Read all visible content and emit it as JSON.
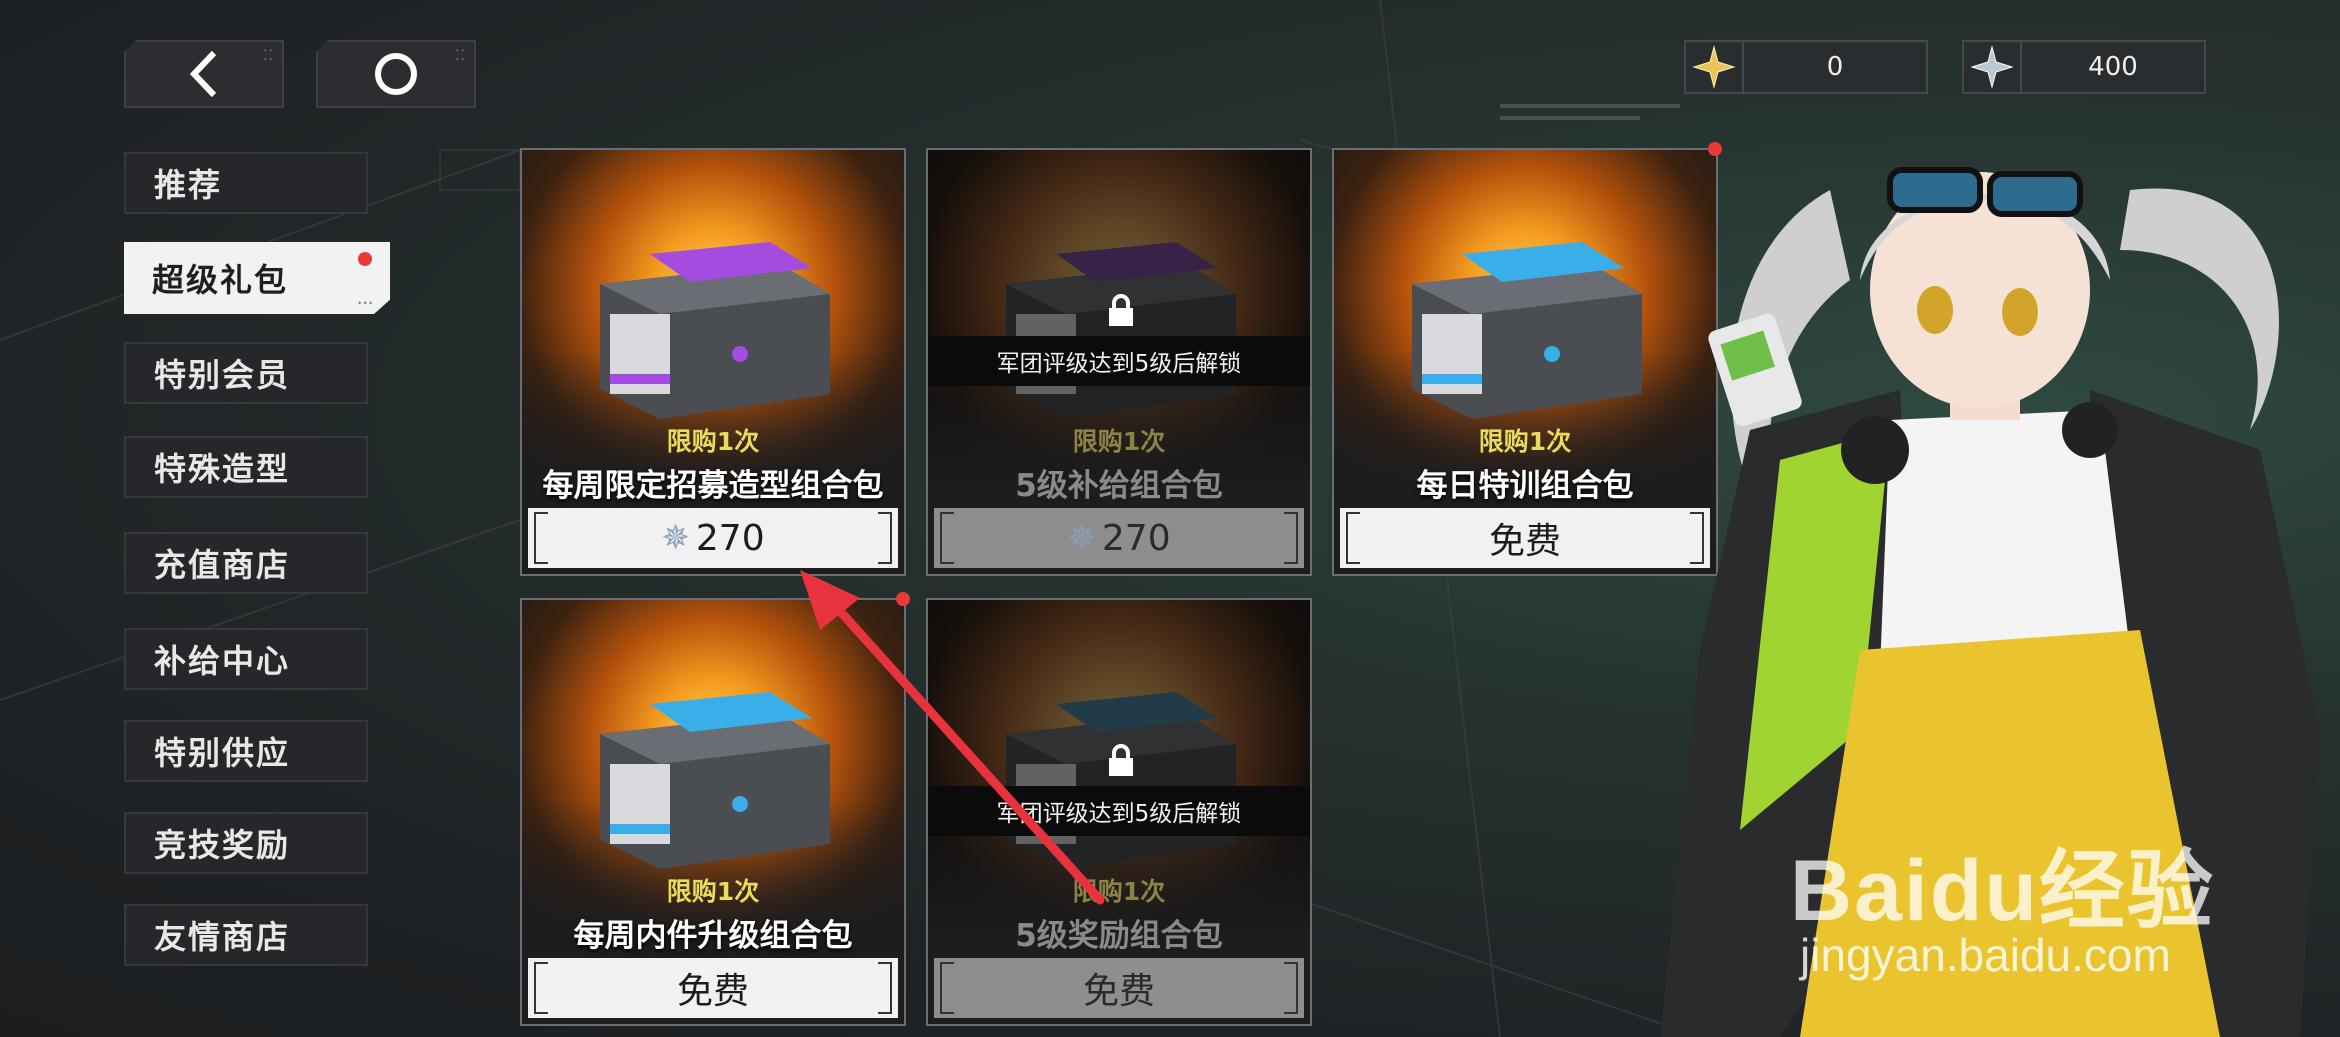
{
  "top_bar": {
    "back_icon": "chevron-left-icon",
    "home_icon": "ring-home-icon",
    "currencies": [
      {
        "icon": "gold-star-icon",
        "value": "0",
        "color": "#e8c45a"
      },
      {
        "icon": "silver-star-icon",
        "value": "400",
        "color": "#b9c7d4"
      }
    ]
  },
  "sidebar": {
    "items": [
      {
        "label": "推荐",
        "active": false
      },
      {
        "label": "超级礼包",
        "active": true,
        "badge": true
      },
      {
        "label": "特别会员",
        "active": false
      },
      {
        "label": "特殊造型",
        "active": false
      },
      {
        "label": "充值商店",
        "active": false
      },
      {
        "label": "补给中心",
        "active": false
      },
      {
        "label": "特别供应",
        "active": false
      },
      {
        "label": "竞技奖励",
        "active": false
      },
      {
        "label": "友情商店",
        "active": false
      }
    ]
  },
  "packs": [
    {
      "name": "每周限定招募造型组合包",
      "limit": "限购1次",
      "price": "270",
      "price_icon": "silver-star-icon",
      "locked": false,
      "badge": false,
      "crate_color": "#a44be0"
    },
    {
      "name": "5级补给组合包",
      "limit": "限购1次",
      "price": "270",
      "price_icon": "silver-star-icon",
      "locked": true,
      "lock_text": "军团评级达到5级后解锁",
      "badge": false,
      "crate_color": "#8b44c8"
    },
    {
      "name": "每日特训组合包",
      "limit": "限购1次",
      "price": "免费",
      "locked": false,
      "badge": true,
      "crate_color": "#3aaee8"
    },
    {
      "name": "每周内件升级组合包",
      "limit": "限购1次",
      "price": "免费",
      "locked": false,
      "badge": true,
      "crate_color": "#3aaee8"
    },
    {
      "name": "5级奖励组合包",
      "limit": "限购1次",
      "price": "免费",
      "locked": true,
      "lock_text": "军团评级达到5级后解锁",
      "badge": false,
      "crate_color": "#2d8ab8"
    }
  ],
  "watermark": {
    "brand": "Baidu经验",
    "url": "jingyan.baidu.com"
  },
  "annotation": {
    "type": "red-arrow",
    "target": "pack-1-price"
  }
}
